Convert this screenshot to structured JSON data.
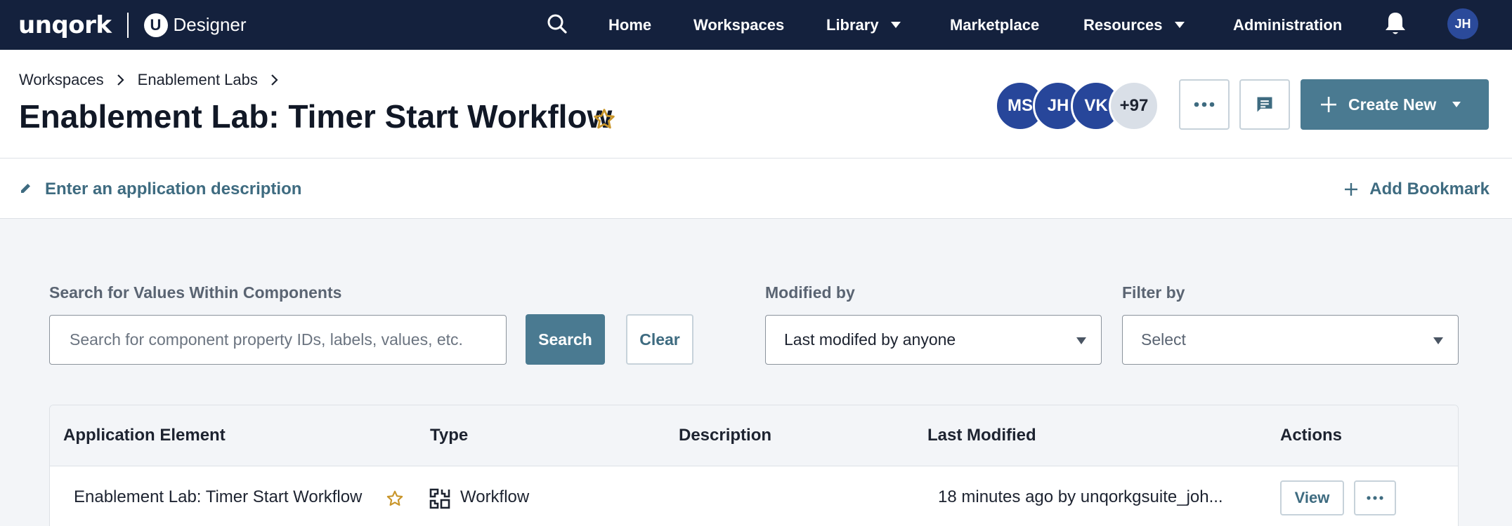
{
  "brand": {
    "logo": "unqork",
    "app_badge": "U",
    "app_name": "Designer"
  },
  "nav": {
    "items": [
      {
        "label": "Home"
      },
      {
        "label": "Workspaces"
      },
      {
        "label": "Library",
        "has_dropdown": true
      },
      {
        "label": "Marketplace"
      },
      {
        "label": "Resources",
        "has_dropdown": true
      },
      {
        "label": "Administration"
      }
    ],
    "user_initials": "JH"
  },
  "breadcrumb": [
    "Workspaces",
    "Enablement Labs"
  ],
  "page": {
    "title": "Enablement Lab: Timer Start Workflow",
    "favorited": true,
    "collaborators": [
      "MS",
      "JH",
      "VK"
    ],
    "collaborators_more": "+97",
    "create_label": "Create New",
    "description_placeholder": "Enter an application description",
    "bookmark_label": "Add Bookmark"
  },
  "filters": {
    "search_label": "Search for Values Within Components",
    "search_placeholder": "Search for component property IDs, labels, values, etc.",
    "search_button": "Search",
    "clear_button": "Clear",
    "modified_label": "Modified by",
    "modified_value": "Last modifed by anyone",
    "filter_label": "Filter by",
    "filter_value": "Select"
  },
  "table": {
    "columns": [
      "Application Element",
      "Type",
      "Description",
      "Last Modified",
      "Actions"
    ],
    "rows": [
      {
        "element": "Enablement Lab: Timer Start Workflow",
        "type": "Workflow",
        "description": "",
        "last_modified": "18 minutes ago by unqorkgsuite_joh...",
        "action_label": "View"
      }
    ]
  },
  "colors": {
    "nav_bg": "#14213d",
    "primary": "#4a7a91",
    "link": "#3e6b80",
    "star": "#c9962b",
    "avatar": "#27469a"
  }
}
